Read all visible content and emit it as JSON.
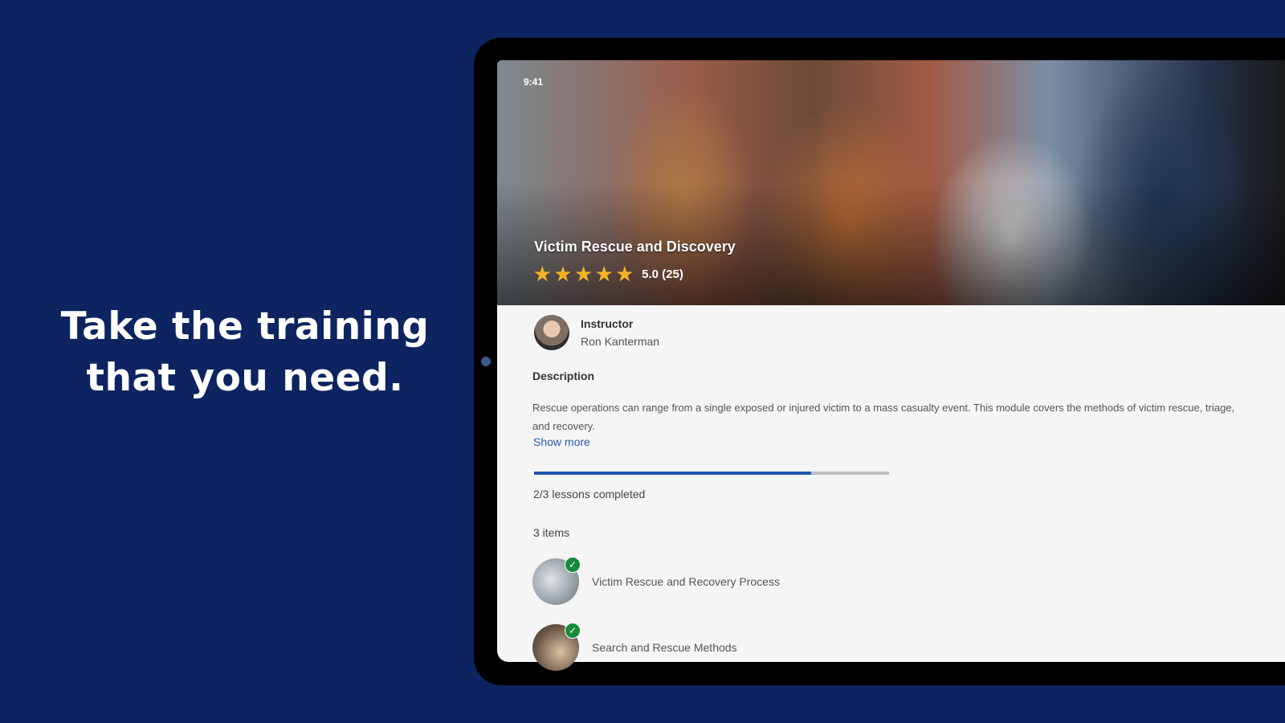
{
  "headline": {
    "line1": "Take the training",
    "line2": "that you need."
  },
  "status_bar": {
    "time": "9:41"
  },
  "course": {
    "title": "Victim Rescue and Discovery",
    "rating_stars": 5,
    "rating_text": "5.0 (25)",
    "instructor_label": "Instructor",
    "instructor_name": "Ron Kanterman",
    "description_label": "Description",
    "description": "Rescue operations can range from a single exposed or injured victim to a mass  casualty event. This module covers the methods of victim rescue, triage, and recovery.",
    "show_more": "Show more",
    "progress_fraction": 0.78,
    "progress_text": "2/3 lessons completed",
    "items_count": "3 items",
    "lessons": [
      {
        "title": "Victim Rescue and Recovery Process",
        "completed": true
      },
      {
        "title": "Search and Rescue Methods",
        "completed": true
      }
    ]
  },
  "colors": {
    "background": "#0e2461",
    "accent": "#1f56b0",
    "star": "#f5b324",
    "check": "#178a3c"
  }
}
